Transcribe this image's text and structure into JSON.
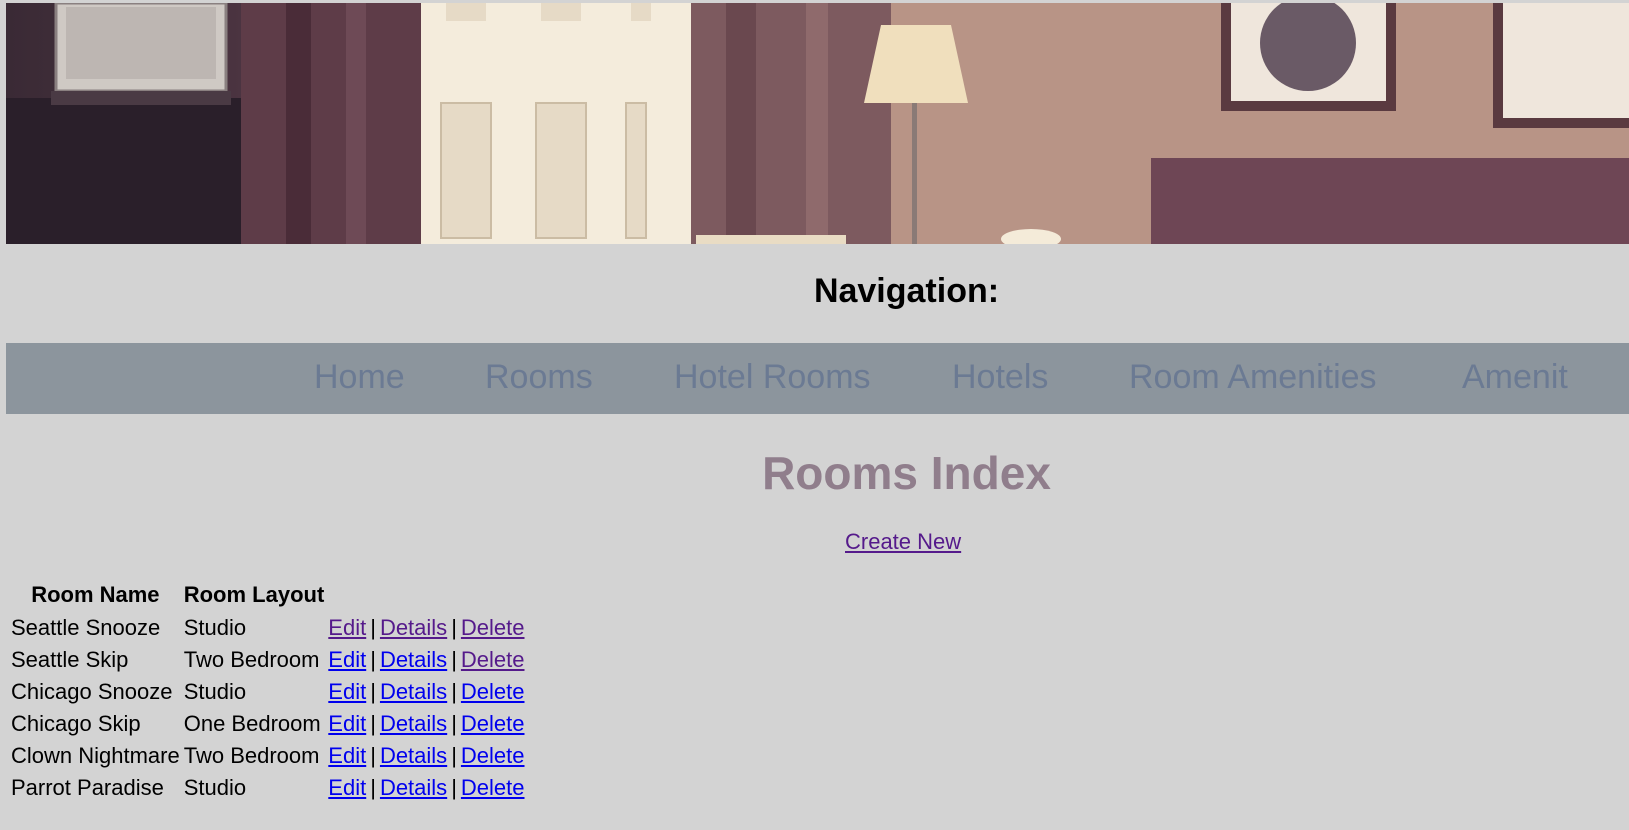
{
  "header": {
    "nav_heading": "Navigation:"
  },
  "nav": {
    "items": [
      {
        "label": "Home"
      },
      {
        "label": "Rooms"
      },
      {
        "label": "Hotel Rooms"
      },
      {
        "label": "Hotels"
      },
      {
        "label": "Room Amenities"
      },
      {
        "label": "Amenit"
      }
    ]
  },
  "main": {
    "title": "Rooms Index",
    "create_new": "Create New",
    "table": {
      "headers": [
        "Room Name",
        "Room Layout"
      ],
      "separator": "|",
      "rows": [
        {
          "name": "Seattle Snooze",
          "layout": "Studio",
          "edit": "Edit",
          "details": "Details",
          "delete": "Delete"
        },
        {
          "name": "Seattle Skip",
          "layout": "Two Bedroom",
          "edit": "Edit",
          "details": "Details",
          "delete": "Delete"
        },
        {
          "name": "Chicago Snooze",
          "layout": "Studio",
          "edit": "Edit",
          "details": "Details",
          "delete": "Delete"
        },
        {
          "name": "Chicago Skip",
          "layout": "One Bedroom",
          "edit": "Edit",
          "details": "Details",
          "delete": "Delete"
        },
        {
          "name": "Clown Nightmare",
          "layout": "Two Bedroom",
          "edit": "Edit",
          "details": "Details",
          "delete": "Delete"
        },
        {
          "name": "Parrot Paradise",
          "layout": "Studio",
          "edit": "Edit",
          "details": "Details",
          "delete": "Delete"
        }
      ]
    }
  },
  "colors": {
    "background": "#d3d3d3",
    "nav_bar": "#8c959d",
    "nav_link": "#6b7a93",
    "title": "#907e8c",
    "visited_link": "#551a8b",
    "unvisited_link": "#0000ee"
  }
}
